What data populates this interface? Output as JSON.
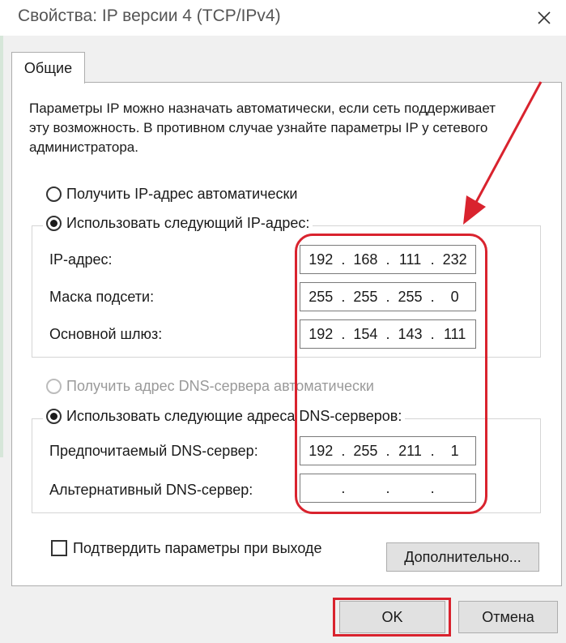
{
  "window": {
    "title": "Свойства: IP версии 4 (TCP/IPv4)",
    "close_icon": "close-icon"
  },
  "tabs": [
    {
      "label": "Общие",
      "active": true
    }
  ],
  "description": "Параметры IP можно назначать автоматически, если сеть поддерживает эту возможность. В противном случае узнайте параметры IP у сетевого администратора.",
  "ip_section": {
    "auto_label": "Получить IP-адрес автоматически",
    "manual_label": "Использовать следующий IP-адрес:",
    "selected": "manual",
    "fields": [
      {
        "label": "IP-адрес:",
        "octets": [
          "192",
          "168",
          "111",
          "232"
        ]
      },
      {
        "label": "Маска подсети:",
        "octets": [
          "255",
          "255",
          "255",
          "0"
        ]
      },
      {
        "label": "Основной шлюз:",
        "octets": [
          "192",
          "154",
          "143",
          "111"
        ]
      }
    ]
  },
  "dns_section": {
    "auto_label": "Получить адрес DNS-сервера автоматически",
    "auto_disabled": true,
    "manual_label": "Использовать следующие адреса DNS-серверов:",
    "selected": "manual",
    "fields": [
      {
        "label": "Предпочитаемый DNS-сервер:",
        "octets": [
          "192",
          "255",
          "211",
          "1"
        ]
      },
      {
        "label": "Альтернативный DNS-сервер:",
        "octets": [
          "",
          "",
          "",
          ""
        ]
      }
    ]
  },
  "validate_on_exit": {
    "label": "Подтвердить параметры при выходе",
    "checked": false
  },
  "buttons": {
    "advanced": "Дополнительно...",
    "ok": "OK",
    "cancel": "Отмена"
  },
  "colors": {
    "annotation_red": "#d9232e",
    "dialog_bg": "#f0f0f0",
    "panel_bg": "#ffffff"
  }
}
